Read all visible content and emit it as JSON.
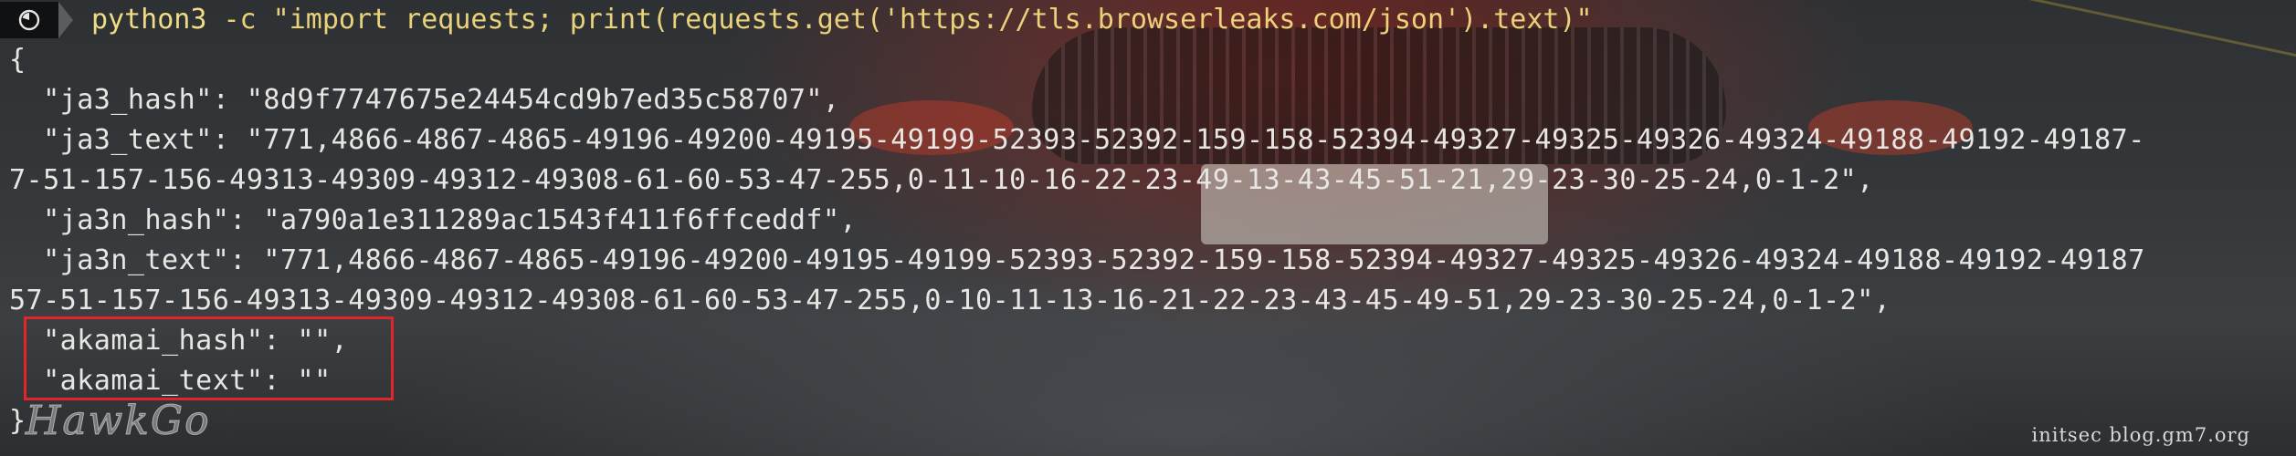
{
  "terminal": {
    "prompt": {
      "icon": "terminal-app-icon",
      "command_name": "python3",
      "command_args": " -c \"import requests; print(requests.get('https://tls.browserleaks.com/json').text)\""
    },
    "output_lines": [
      "{",
      "  \"ja3_hash\": \"8d9f7747675e24454cd9b7ed35c58707\",",
      "  \"ja3_text\": \"771,4866-4867-4865-49196-49200-49195-49199-52393-52392-159-158-52394-49327-49325-49326-49324-49188-49192-49187-",
      "7-51-157-156-49313-49309-49312-49308-61-60-53-47-255,0-11-10-16-22-23-49-13-43-45-51-21,29-23-30-25-24,0-1-2\",",
      "  \"ja3n_hash\": \"a790a1e311289ac1543f411f6ffceddf\",",
      "  \"ja3n_text\": \"771,4866-4867-4865-49196-49200-49195-49199-52393-52392-159-158-52394-49327-49325-49326-49324-49188-49192-49187",
      "57-51-157-156-49313-49309-49312-49308-61-60-53-47-255,0-10-11-13-16-21-22-23-43-45-49-51,29-23-30-25-24,0-1-2\",",
      "  \"akamai_hash\": \"\",",
      "  \"akamai_text\": \"\"",
      "}"
    ]
  },
  "watermark": {
    "logo": "HawkGo",
    "credit": "initsec blog.gm7.org"
  },
  "colors": {
    "command": "#e9d27a",
    "output": "#e8e6e3",
    "highlight_border": "#e0262b",
    "prompt_badge": "#0f1112"
  }
}
